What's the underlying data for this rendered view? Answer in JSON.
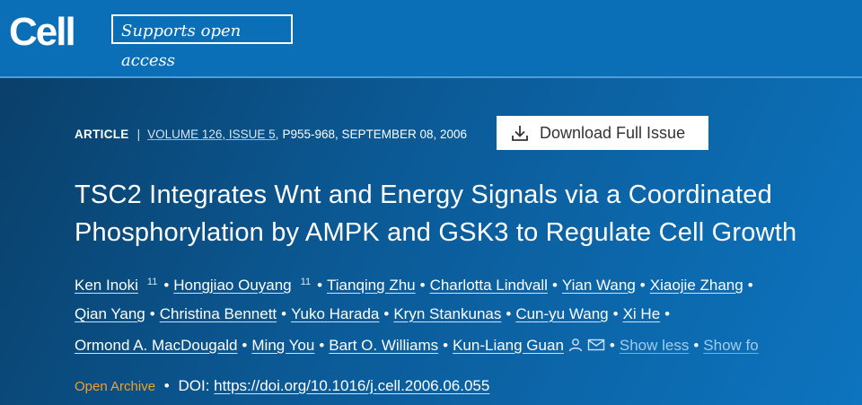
{
  "header": {
    "logo": "Cell",
    "access_badge": "Supports open access"
  },
  "meta": {
    "article_type": "ARTICLE",
    "separator": "|",
    "volume_issue": "VOLUME 126, ISSUE 5,",
    "pages_date": "P955-968, SEPTEMBER 08, 2006",
    "download_label": "Download Full Issue"
  },
  "title": {
    "line1": "TSC2 Integrates Wnt and Energy Signals via a Coordinated",
    "line2": "Phosphorylation by AMPK and GSK3 to Regulate Cell Growth"
  },
  "authors": {
    "line1": [
      "Ken Inoki",
      "Hongjiao Ouyang",
      "Tianqing Zhu",
      "Charlotta Lindvall",
      "Yian Wang",
      "Xiaojie Zhang"
    ],
    "footnote_mark": "11",
    "line2": [
      "Qian Yang",
      "Christina Bennett",
      "Yuko Harada",
      "Kryn Stankunas",
      "Cun-yu Wang",
      "Xi He"
    ],
    "line3": [
      "Ormond A. MacDougald",
      "Ming You",
      "Bart O. Williams",
      "Kun-Liang Guan"
    ],
    "show_less": "Show less",
    "show_footnotes": "Show fo"
  },
  "footer": {
    "open_archive": "Open Archive",
    "doi_label": "DOI:",
    "doi_url": "https://doi.org/10.1016/j.cell.2006.06.055"
  },
  "colors": {
    "header_bg": "#0a6fb7",
    "open_archive": "#f0a030",
    "link_light": "#9fcdf0"
  },
  "icons": [
    "download-icon",
    "person-icon",
    "envelope-icon"
  ]
}
